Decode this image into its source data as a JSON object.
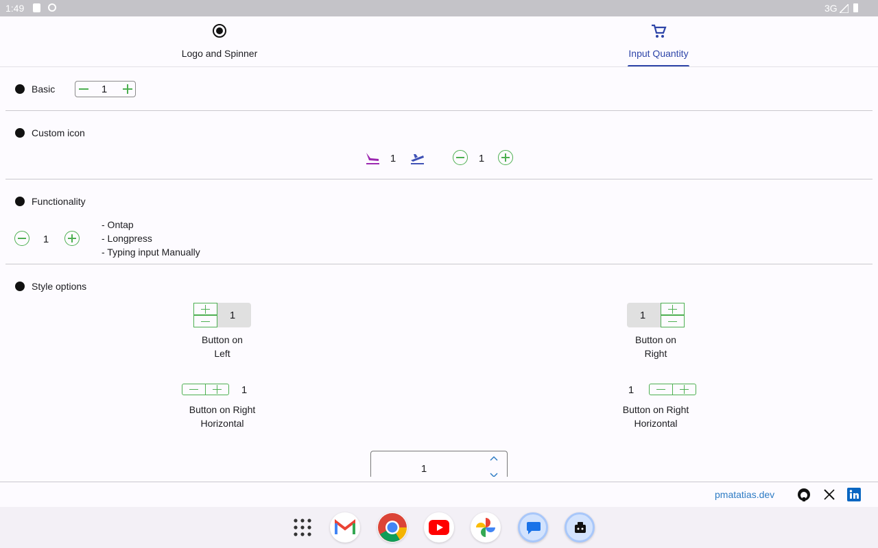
{
  "status": {
    "time": "1:49",
    "network": "3G"
  },
  "tabs": [
    {
      "label": "Logo and Spinner",
      "icon": "radio-button-icon",
      "active": false
    },
    {
      "label": "Input Quantity",
      "icon": "cart-icon",
      "active": true
    }
  ],
  "basic": {
    "title": "Basic",
    "value": "1"
  },
  "custom_icon": {
    "title": "Custom icon",
    "value_1": "1",
    "value_2": "1"
  },
  "functionality": {
    "title": "Functionality",
    "value": "1",
    "items": [
      "- Ontap",
      "- Longpress",
      "- Typing input Manually"
    ]
  },
  "style_options": {
    "title": "Style options",
    "left": {
      "value": "1",
      "caption_1": "Button on",
      "caption_2": "Left"
    },
    "right": {
      "value": "1",
      "caption_1": "Button on",
      "caption_2": "Right"
    },
    "left_h": {
      "value": "1",
      "caption_1": "Button on Right",
      "caption_2": "Horizontal"
    },
    "right_h": {
      "value": "1",
      "caption_1": "Button on Right",
      "caption_2": "Horizontal"
    },
    "bottom": {
      "value": "1"
    }
  },
  "footer": {
    "link": "pmatatias.dev"
  },
  "colors": {
    "accent": "#2d44a8",
    "green": "#4caf50",
    "purple": "#9c27b0",
    "blue": "#3f51b5"
  }
}
